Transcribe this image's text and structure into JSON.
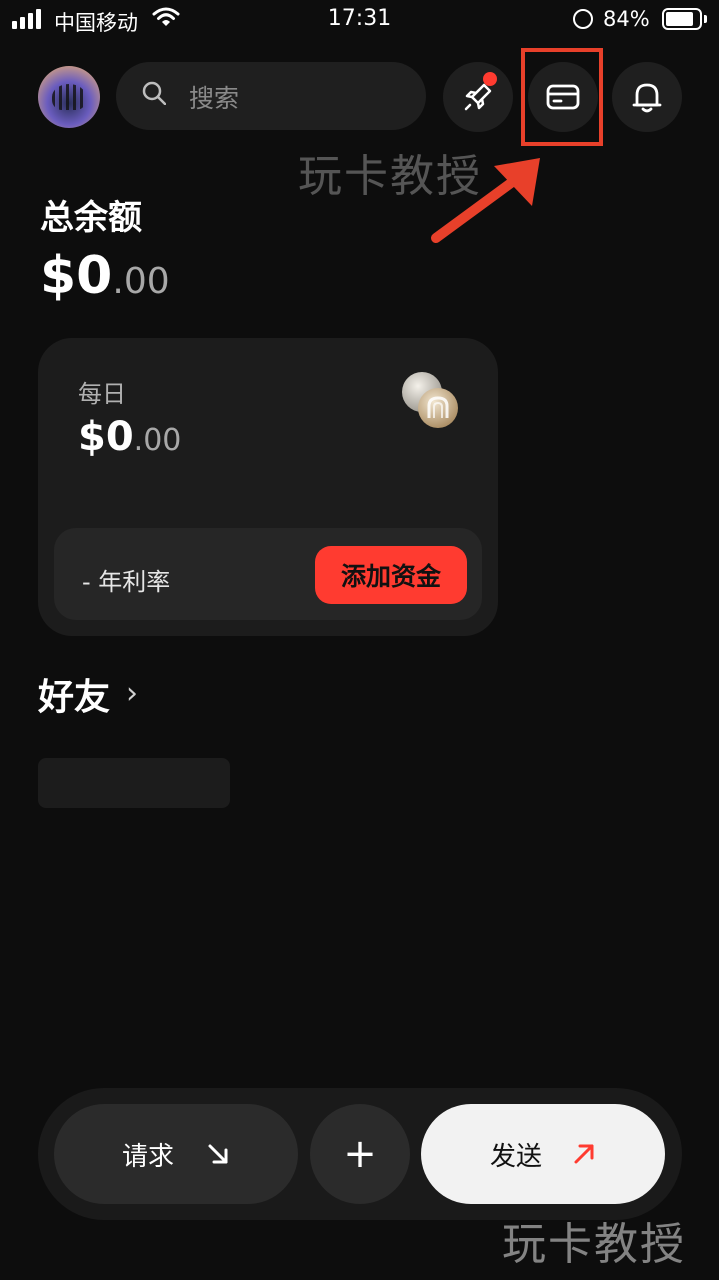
{
  "status_bar": {
    "carrier": "中国移动",
    "time": "17:31",
    "battery": "84%"
  },
  "header": {
    "search_placeholder": "搜索",
    "icons": [
      "avatar",
      "search-icon",
      "rocket-icon",
      "card-icon",
      "bell-icon"
    ],
    "notification_dot_color": "#ff3b30"
  },
  "watermark": "玩卡教授",
  "balance": {
    "label": "总余额",
    "amount_main": "$0",
    "amount_cents": ".00"
  },
  "daily": {
    "label": "每日",
    "amount_main": "$0",
    "amount_cents": ".00",
    "rate_label": "- 年利率",
    "add_funds_button": "添加资金",
    "accent_color": "#ff3b30"
  },
  "friends": {
    "title": "好友"
  },
  "bottom_nav": {
    "request_label": "请求",
    "plus_label": "+",
    "send_label": "发送"
  },
  "annotation": {
    "highlight_color": "#e8402a"
  }
}
